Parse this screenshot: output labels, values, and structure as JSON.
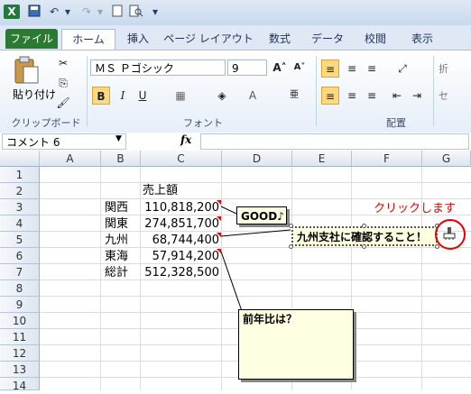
{
  "quick_access": {
    "save_icon": "save-icon",
    "undo_icon": "undo-icon",
    "redo_icon": "redo-icon",
    "new_icon": "new-doc-icon",
    "preview_icon": "print-preview-icon"
  },
  "tabs": [
    "ファイル",
    "ホーム",
    "挿入",
    "ページ レイアウト",
    "数式",
    "データ",
    "校閲",
    "表示"
  ],
  "ribbon": {
    "clipboard": {
      "paste_label": "貼り付け",
      "group_label": "クリップボード"
    },
    "font": {
      "font_name": "ＭＳ Ｐゴシック",
      "font_size": "9",
      "bold": "B",
      "italic": "I",
      "underline": "U",
      "group_label": "フォント"
    },
    "alignment": {
      "group_label": "配置",
      "wrap_label": "折",
      "merge_label": "セ"
    }
  },
  "formula_bar": {
    "name_box": "コメント 6",
    "fx": "fx",
    "value": ""
  },
  "columns": [
    "A",
    "B",
    "C",
    "D",
    "E",
    "F",
    "G"
  ],
  "rows": [
    "1",
    "2",
    "3",
    "4",
    "5",
    "6",
    "7",
    "8",
    "9",
    "10",
    "11",
    "12",
    "13",
    "14"
  ],
  "sheet": {
    "header": "売上額",
    "regions": [
      "関西",
      "関東",
      "九州",
      "東海",
      "総計"
    ],
    "values": [
      "110,818,200",
      "274,851,700",
      "68,744,400",
      "57,914,200",
      "512,328,500"
    ]
  },
  "comments": {
    "good": "GOOD♪",
    "kyushu": "九州支社に確認すること！",
    "yoy": "前年比は？"
  },
  "annotation": {
    "click_text": "クリックします",
    "click_color": "#e60000"
  }
}
